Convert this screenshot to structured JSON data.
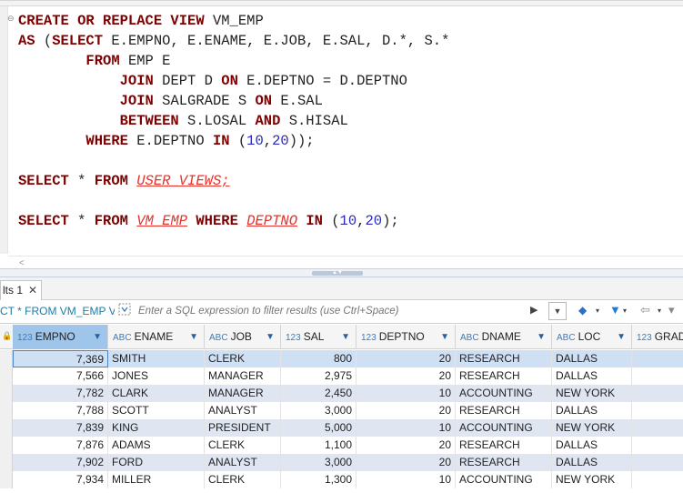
{
  "editor": {
    "fold_marker": "⊖",
    "lines": [
      [
        {
          "t": "CREATE OR REPLACE VIEW ",
          "c": "kw"
        },
        {
          "t": "VM_EMP",
          "c": "plain"
        }
      ],
      [
        {
          "t": "AS ",
          "c": "kw"
        },
        {
          "t": "(",
          "c": "plain"
        },
        {
          "t": "SELECT ",
          "c": "kw"
        },
        {
          "t": "E.EMPNO, E.ENAME, E.JOB, E.SAL, D.*, S.*",
          "c": "plain"
        }
      ],
      [
        {
          "t": "        ",
          "c": "plain"
        },
        {
          "t": "FROM ",
          "c": "kw"
        },
        {
          "t": "EMP E",
          "c": "plain"
        }
      ],
      [
        {
          "t": "            ",
          "c": "plain"
        },
        {
          "t": "JOIN ",
          "c": "kw"
        },
        {
          "t": "DEPT D ",
          "c": "plain"
        },
        {
          "t": "ON ",
          "c": "kw"
        },
        {
          "t": "E.DEPTNO = D.DEPTNO",
          "c": "plain"
        }
      ],
      [
        {
          "t": "            ",
          "c": "plain"
        },
        {
          "t": "JOIN ",
          "c": "kw"
        },
        {
          "t": "SALGRADE S ",
          "c": "plain"
        },
        {
          "t": "ON ",
          "c": "kw"
        },
        {
          "t": "E.SAL",
          "c": "plain"
        }
      ],
      [
        {
          "t": "            ",
          "c": "plain"
        },
        {
          "t": "BETWEEN ",
          "c": "kw"
        },
        {
          "t": "S.LOSAL ",
          "c": "plain"
        },
        {
          "t": "AND ",
          "c": "kw"
        },
        {
          "t": "S.HISAL",
          "c": "plain"
        }
      ],
      [
        {
          "t": "        ",
          "c": "plain"
        },
        {
          "t": "WHERE ",
          "c": "kw"
        },
        {
          "t": "E.DEPTNO ",
          "c": "plain"
        },
        {
          "t": "IN ",
          "c": "kw"
        },
        {
          "t": "(",
          "c": "plain"
        },
        {
          "t": "10",
          "c": "num"
        },
        {
          "t": ",",
          "c": "plain"
        },
        {
          "t": "20",
          "c": "num"
        },
        {
          "t": "));",
          "c": "plain"
        }
      ],
      [],
      [
        {
          "t": "SELECT ",
          "c": "kw"
        },
        {
          "t": "* ",
          "c": "plain"
        },
        {
          "t": "FROM ",
          "c": "kw"
        },
        {
          "t": "USER_VIEWS",
          "c": "tbl"
        },
        {
          "t": ";",
          "c": "tbl"
        }
      ],
      [],
      [
        {
          "t": "SELECT ",
          "c": "kw"
        },
        {
          "t": "* ",
          "c": "plain"
        },
        {
          "t": "FROM ",
          "c": "kw"
        },
        {
          "t": "VM_EMP",
          "c": "tbl"
        },
        {
          "t": " ",
          "c": "plain"
        },
        {
          "t": "WHERE ",
          "c": "kw"
        },
        {
          "t": "DEPTNO",
          "c": "tbl"
        },
        {
          "t": " ",
          "c": "plain"
        },
        {
          "t": "IN ",
          "c": "kw"
        },
        {
          "t": "(",
          "c": "plain"
        },
        {
          "t": "10",
          "c": "num"
        },
        {
          "t": ",",
          "c": "plain"
        },
        {
          "t": "20",
          "c": "num"
        },
        {
          "t": ");",
          "c": "plain"
        }
      ]
    ]
  },
  "hscroll_arrow": "<",
  "splitter_handle": "▲▼",
  "results": {
    "tab_label": "lts 1",
    "tab_close": "✕",
    "query_label": "CT * FROM VM_EMP V",
    "filter_placeholder": "Enter a SQL expression to filter results (use Ctrl+Space)",
    "filter_run": "▶",
    "filter_drop": "▼",
    "erase_icon": "◆",
    "funnel_icon": "▼",
    "back_icon": "⇦",
    "fwd_icon": "▾",
    "drop_arrow": "▾"
  },
  "grid": {
    "lock": "🔒",
    "columns": [
      {
        "type": "123",
        "name": "EMPNO",
        "active": true
      },
      {
        "type": "ABC",
        "name": "ENAME"
      },
      {
        "type": "ABC",
        "name": "JOB"
      },
      {
        "type": "123",
        "name": "SAL"
      },
      {
        "type": "123",
        "name": "DEPTNO"
      },
      {
        "type": "ABC",
        "name": "DNAME"
      },
      {
        "type": "ABC",
        "name": "LOC"
      },
      {
        "type": "123",
        "name": "GRAD"
      }
    ],
    "rows": [
      [
        "7,369",
        "SMITH",
        "CLERK",
        "800",
        "20",
        "RESEARCH",
        "DALLAS"
      ],
      [
        "7,566",
        "JONES",
        "MANAGER",
        "2,975",
        "20",
        "RESEARCH",
        "DALLAS"
      ],
      [
        "7,782",
        "CLARK",
        "MANAGER",
        "2,450",
        "10",
        "ACCOUNTING",
        "NEW YORK"
      ],
      [
        "7,788",
        "SCOTT",
        "ANALYST",
        "3,000",
        "20",
        "RESEARCH",
        "DALLAS"
      ],
      [
        "7,839",
        "KING",
        "PRESIDENT",
        "5,000",
        "10",
        "ACCOUNTING",
        "NEW YORK"
      ],
      [
        "7,876",
        "ADAMS",
        "CLERK",
        "1,100",
        "20",
        "RESEARCH",
        "DALLAS"
      ],
      [
        "7,902",
        "FORD",
        "ANALYST",
        "3,000",
        "20",
        "RESEARCH",
        "DALLAS"
      ],
      [
        "7,934",
        "MILLER",
        "CLERK",
        "1,300",
        "10",
        "ACCOUNTING",
        "NEW YORK"
      ]
    ]
  }
}
